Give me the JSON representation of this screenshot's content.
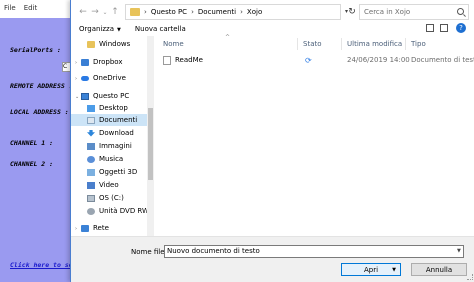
{
  "background_app": {
    "menu": [
      "File",
      "Edit"
    ],
    "labels": [
      "SerialPorts :",
      "REMOTE ADDRESS :",
      "LOCAL ADDRESS :",
      "CHANNEL 1 :",
      "CHANNEL 2 :"
    ],
    "link_text": "Click here to se",
    "partial_control": "C"
  },
  "dialog": {
    "breadcrumb": [
      "Questo PC",
      "Documenti",
      "Xojo"
    ],
    "search_placeholder": "Cerca in Xojo",
    "toolbar": {
      "organize_label": "Organizza",
      "new_folder_label": "Nuova cartella"
    },
    "sidebar": {
      "items": [
        {
          "label": "Windows",
          "icon": "folder-icon"
        },
        {
          "label": "Dropbox",
          "icon": "dropbox-icon"
        },
        {
          "label": "OneDrive",
          "icon": "cloud-icon"
        },
        {
          "label": "Questo PC",
          "icon": "computer-icon"
        },
        {
          "label": "Desktop",
          "icon": "desktop-icon"
        },
        {
          "label": "Documenti",
          "icon": "documents-icon",
          "selected": true
        },
        {
          "label": "Download",
          "icon": "download-icon"
        },
        {
          "label": "Immagini",
          "icon": "pictures-icon"
        },
        {
          "label": "Musica",
          "icon": "music-icon"
        },
        {
          "label": "Oggetti 3D",
          "icon": "3d-objects-icon"
        },
        {
          "label": "Video",
          "icon": "video-icon"
        },
        {
          "label": "OS (C:)",
          "icon": "drive-icon"
        },
        {
          "label": "Unità DVD RW (",
          "icon": "dvd-drive-icon"
        },
        {
          "label": "Rete",
          "icon": "network-icon"
        }
      ]
    },
    "columns": [
      "Nome",
      "Stato",
      "Ultima modifica",
      "Tipo"
    ],
    "files": [
      {
        "name": "ReadMe",
        "status_icon": "sync-icon",
        "modified": "24/06/2019 14:00",
        "type": "Documento di testo"
      }
    ],
    "footer": {
      "filename_label": "Nome file:",
      "filename_value": "Nuovo documento di testo",
      "open_label": "Apri",
      "cancel_label": "Annulla"
    }
  }
}
